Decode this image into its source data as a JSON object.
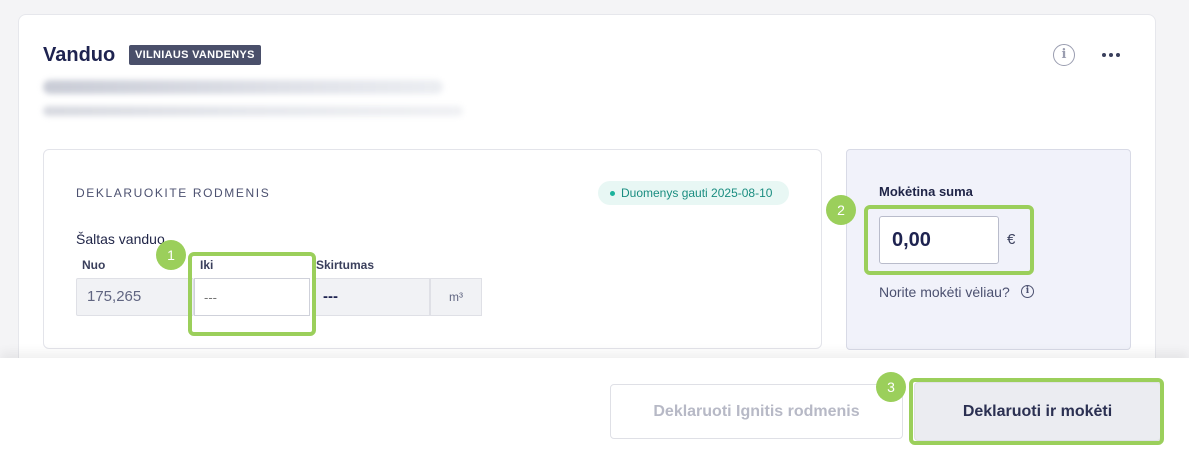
{
  "card": {
    "title": "Vanduo",
    "provider_badge": "VILNIAUS VANDENYS"
  },
  "icons": {
    "info": "i",
    "more": "more-horizontal-icon"
  },
  "declaration": {
    "heading": "DEKLARUOKITE RODMENIS",
    "status": "Duomenys gauti 2025-08-10",
    "meter_name": "Šaltas vanduo",
    "labels": {
      "from": "Nuo",
      "to": "Iki",
      "difference": "Skirtumas"
    },
    "from_value": "175,265",
    "to_placeholder": "---",
    "difference_value": "---",
    "unit": "m³"
  },
  "payment": {
    "title": "Mokėtina suma",
    "amount": "0,00",
    "currency": "€",
    "later_link": "Norite mokėti vėliau?",
    "later_icon": "i"
  },
  "footer": {
    "secondary_button": "Deklaruoti Ignitis rodmenis",
    "primary_button": "Deklaruoti ir mokėti"
  },
  "annotations": [
    "1",
    "2",
    "3"
  ],
  "colors": {
    "highlight": "#9bcf5b",
    "title": "#1e2350",
    "status_bg": "#e8f7f4",
    "status_text": "#1a8d80",
    "panel_bg": "#f1f2fa"
  }
}
